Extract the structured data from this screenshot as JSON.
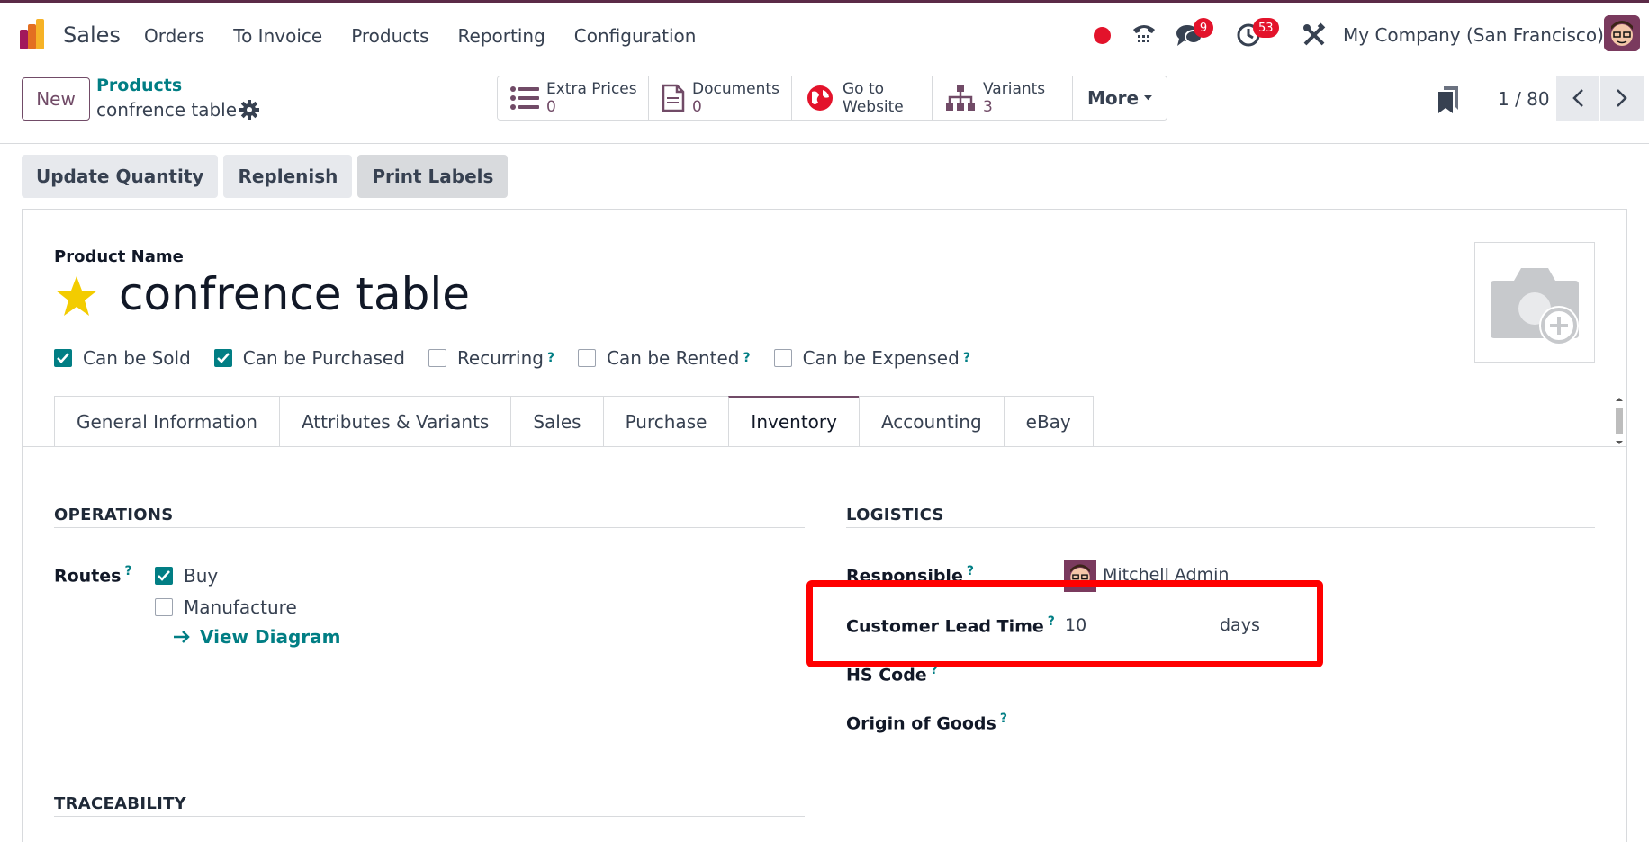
{
  "navbar": {
    "app_name": "Sales",
    "menu": [
      "Orders",
      "To Invoice",
      "Products",
      "Reporting",
      "Configuration"
    ],
    "messages_badge": "9",
    "activities_badge": "53",
    "company": "My Company (San Francisco)"
  },
  "control_panel": {
    "new_label": "New",
    "breadcrumb_parent": "Products",
    "breadcrumb_current": "confrence table",
    "smart_buttons": [
      {
        "label": "Extra Prices",
        "value": "0",
        "icon": "list-icon"
      },
      {
        "label": "Documents",
        "value": "0",
        "icon": "document-icon"
      },
      {
        "label": "Go to",
        "value": "Website",
        "icon": "globe-icon"
      },
      {
        "label": "Variants",
        "value": "3",
        "icon": "sitemap-icon"
      }
    ],
    "more_label": "More",
    "pager": "1 / 80"
  },
  "header_buttons": [
    "Update Quantity",
    "Replenish",
    "Print Labels"
  ],
  "form": {
    "product_name_label": "Product Name",
    "product_name": "confrence table",
    "checkboxes": [
      {
        "label": "Can be Sold",
        "checked": true,
        "help": false
      },
      {
        "label": "Can be Purchased",
        "checked": true,
        "help": false
      },
      {
        "label": "Recurring",
        "checked": false,
        "help": true
      },
      {
        "label": "Can be Rented",
        "checked": false,
        "help": true
      },
      {
        "label": "Can be Expensed",
        "checked": false,
        "help": true
      }
    ],
    "tabs": [
      "General Information",
      "Attributes & Variants",
      "Sales",
      "Purchase",
      "Inventory",
      "Accounting",
      "eBay"
    ],
    "active_tab": "Inventory",
    "operations": {
      "title": "OPERATIONS",
      "routes_label": "Routes",
      "routes": [
        {
          "label": "Buy",
          "checked": true
        },
        {
          "label": "Manufacture",
          "checked": false
        }
      ],
      "view_diagram": "View Diagram"
    },
    "logistics": {
      "title": "LOGISTICS",
      "responsible_label": "Responsible",
      "responsible_value": "Mitchell Admin",
      "lead_time_label": "Customer Lead Time",
      "lead_time_value": "10",
      "lead_time_unit": "days",
      "hs_code_label": "HS Code",
      "origin_label": "Origin of Goods"
    },
    "traceability_title": "TRACEABILITY"
  },
  "colors": {
    "brand": "#714b67",
    "accent": "#017e84",
    "highlight": "#ff0000"
  }
}
